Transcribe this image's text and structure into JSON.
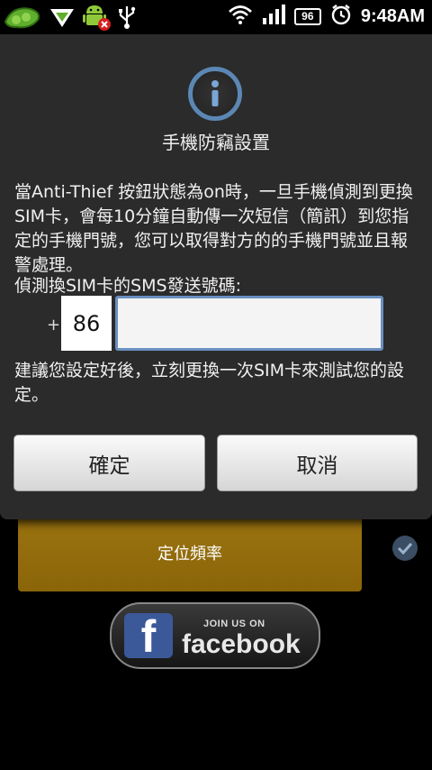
{
  "status_bar": {
    "icons": [
      "pea-pod-icon",
      "signal-app-icon",
      "android-alert-icon",
      "usb-icon"
    ],
    "battery": "96",
    "time": "9:48AM"
  },
  "dialog": {
    "icon": "info-icon",
    "title": "手機防竊設置",
    "message": "當Anti-Thief 按鈕狀態為on時，一旦手機偵測到更換SIM卡，會每10分鐘自動傳一次短信（簡訊）到您指定的手機門號，您可以取得對方的的手機門號並且報警處理。",
    "sms_label": "偵測換SIM卡的SMS發送號碼:",
    "plus": "+",
    "country_code": "86",
    "phone_value": "",
    "phone_placeholder": "",
    "hint": "建議您設定好後，立刻更換一次SIM卡來測試您的設定。",
    "ok_label": "確定",
    "cancel_label": "取消"
  },
  "background": {
    "row_label": "定位頻率",
    "facebook": {
      "join": "JOIN US ON",
      "brand": "facebook",
      "logo_letter": "f"
    }
  },
  "colors": {
    "accent": "#5b87b4",
    "dialog_bg": "#2b2b2b",
    "row_gold": "#9c7410",
    "facebook_blue": "#3b5998"
  }
}
